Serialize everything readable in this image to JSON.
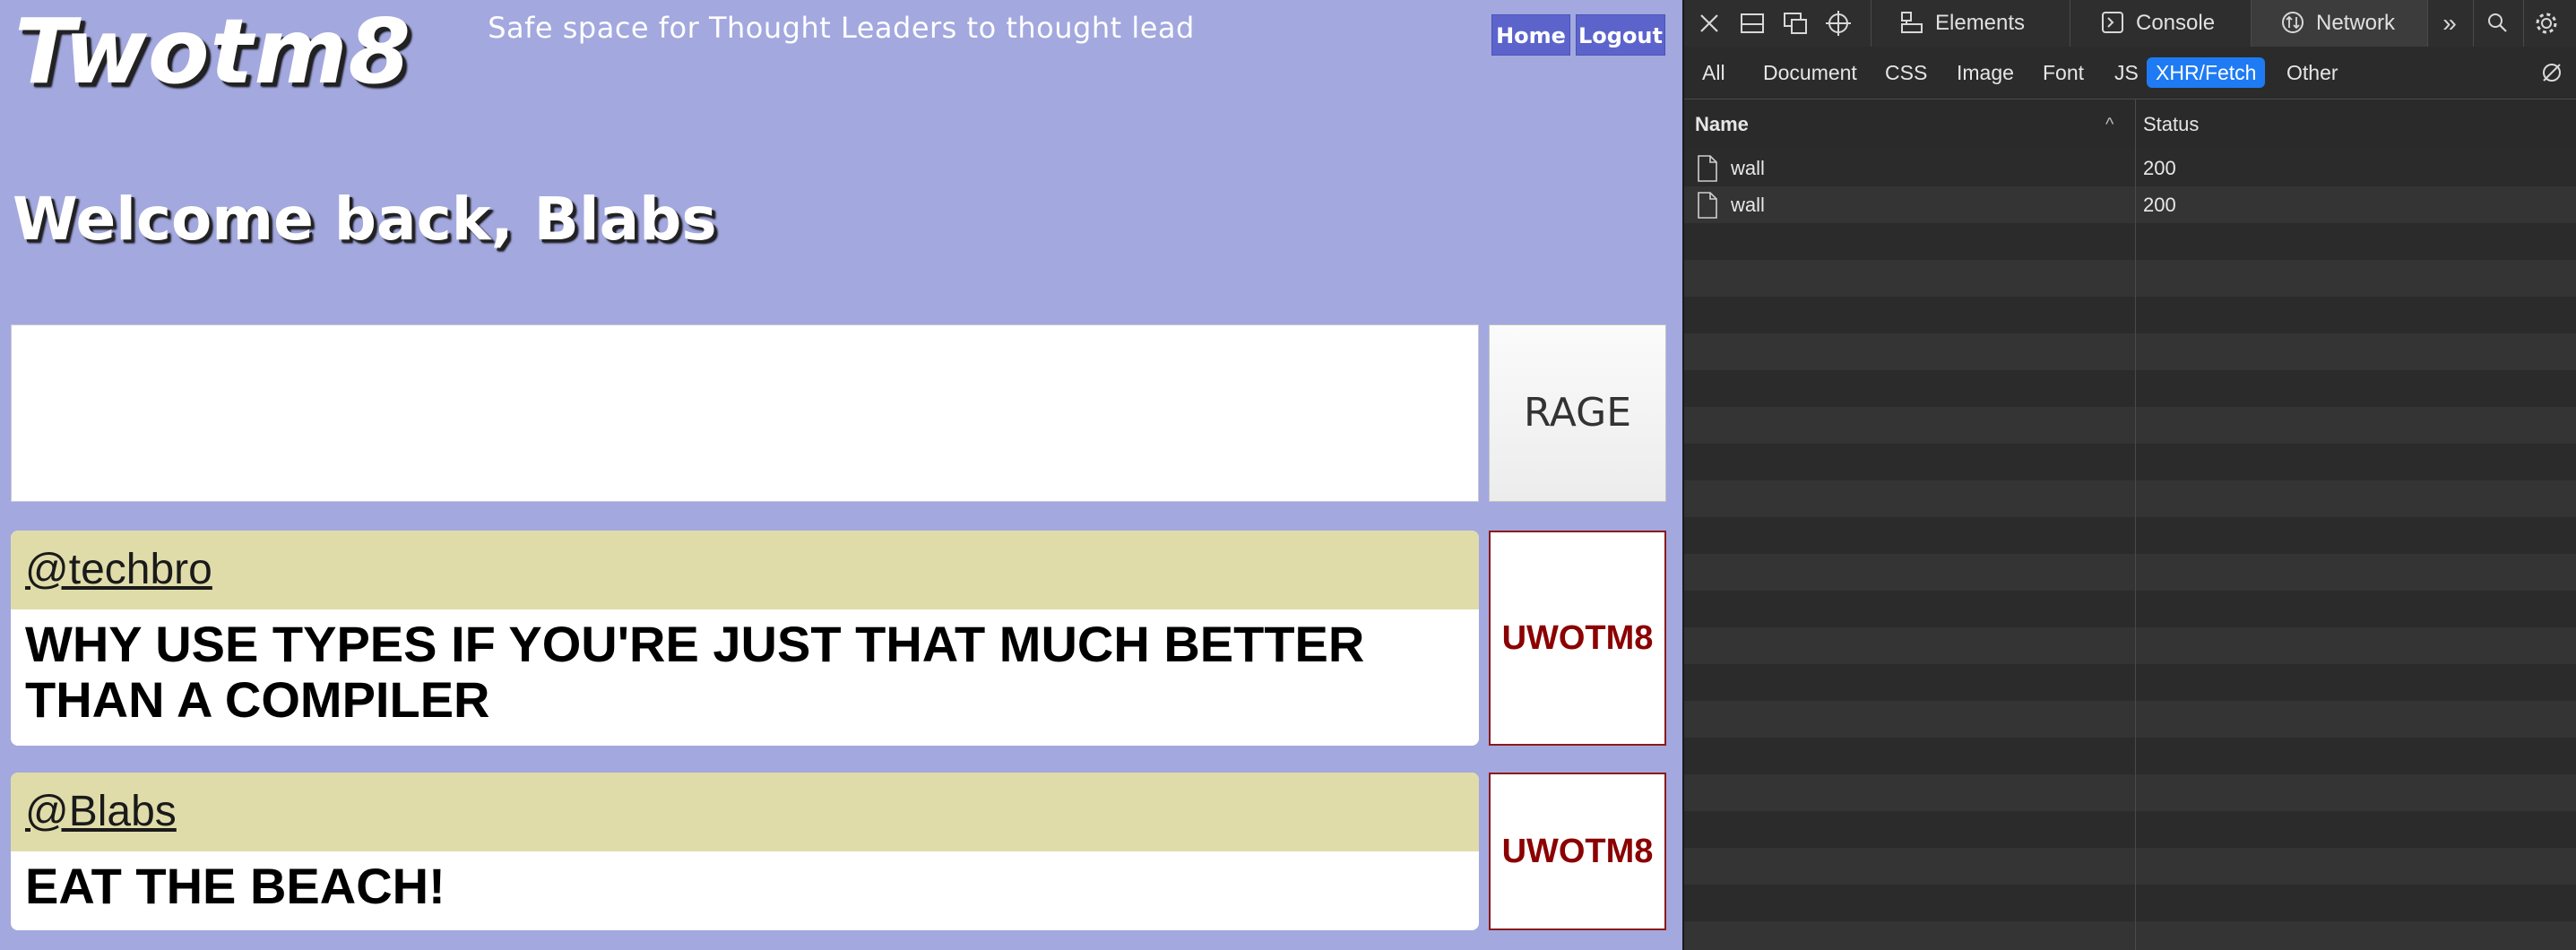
{
  "app": {
    "logo": "Twotm8",
    "tagline": "Safe space for Thought Leaders to thought lead",
    "nav": {
      "home": "Home",
      "logout": "Logout"
    },
    "welcome": "Welcome back, Blabs",
    "compose": {
      "value": "",
      "placeholder": "",
      "submit_label": "RAGE"
    },
    "posts": [
      {
        "user": "@techbro",
        "text": "WHY USE TYPES IF YOU'RE JUST THAT MUCH BETTER THAN A COMPILER",
        "action": "UWOTM8"
      },
      {
        "user": "@Blabs",
        "text": "EAT THE BEACH!",
        "action": "UWOTM8"
      }
    ]
  },
  "devtools": {
    "toolbar_icons": [
      "close-icon",
      "dock-bottom-icon",
      "device-mode-icon",
      "inspect-icon"
    ],
    "tabs": [
      {
        "label": "Elements",
        "icon": "elements-icon"
      },
      {
        "label": "Console",
        "icon": "console-icon"
      },
      {
        "label": "Network",
        "icon": "network-icon",
        "active": true
      }
    ],
    "overflow_icon": "»",
    "filters": [
      "All",
      "Document",
      "CSS",
      "Image",
      "Font",
      "JS",
      "XHR/Fetch",
      "Other"
    ],
    "active_filter": "XHR/Fetch",
    "columns": {
      "name": "Name",
      "status": "Status",
      "sort_glyph": "^"
    },
    "requests": [
      {
        "name": "wall",
        "status": "200"
      },
      {
        "name": "wall",
        "status": "200"
      }
    ],
    "colors": {
      "active_filter_bg": "#1e7bf3",
      "background": "#282828"
    }
  }
}
